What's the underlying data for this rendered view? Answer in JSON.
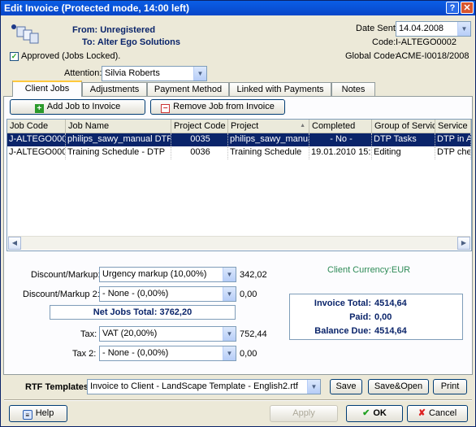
{
  "window": {
    "title": "Edit Invoice (Protected mode, 14:00 left)"
  },
  "header": {
    "from": "From: Unregistered",
    "to": "To: Alter Ego Solutions",
    "approved_label": "Approved (Jobs Locked).",
    "approved_checked": true,
    "attention_label": "Attention:",
    "attention_value": "Silvia Roberts",
    "date_sent_label": "Date Sent:",
    "date_sent_value": "14.04.2008",
    "code_label": "Code:",
    "code_value": "I-ALTEGO0002",
    "global_code_label": "Global Code:",
    "global_code_value": "ACME-I0018/2008"
  },
  "tabs": [
    {
      "label": "Client Jobs",
      "active": true
    },
    {
      "label": "Adjustments",
      "active": false
    },
    {
      "label": "Payment Method",
      "active": false
    },
    {
      "label": "Linked with Payments",
      "active": false
    },
    {
      "label": "Notes",
      "active": false
    }
  ],
  "toolbar": {
    "add_job_label": "Add Job to Invoice",
    "remove_job_label": "Remove Job from Invoice"
  },
  "jobs_table": {
    "columns": [
      "Job Code",
      "Job Name",
      "Project Code",
      "Project",
      "Completed",
      "Group of Service",
      "Service"
    ],
    "rows": [
      [
        "J-ALTEGO000",
        "philips_sawy_manual DTP",
        "0035",
        "philips_sawy_manual",
        "- No -",
        "DTP Tasks",
        "DTP in Ad"
      ],
      [
        "J-ALTEGO000",
        "Training Schedule - DTP",
        "0036",
        "Training Schedule",
        "19.01.2010 15:1",
        "Editing",
        "DTP check"
      ]
    ]
  },
  "totals": {
    "discount_label": "Discount/Markup:",
    "discount_value": "Urgency markup (10,00%)",
    "discount_amount": "342,02",
    "discount2_label": "Discount/Markup 2:",
    "discount2_value": "- None - (0,00%)",
    "discount2_amount": "0,00",
    "net_jobs_total": "Net Jobs Total: 3762,20",
    "tax_label": "Tax:",
    "tax_value": "VAT (20,00%)",
    "tax_amount": "752,44",
    "tax2_label": "Tax 2:",
    "tax2_value": "- None - (0,00%)",
    "tax2_amount": "0,00",
    "client_currency": "Client Currency:EUR",
    "invoice_total_label": "Invoice Total:",
    "invoice_total_value": "4514,64",
    "paid_label": "Paid:",
    "paid_value": "0,00",
    "balance_due_label": "Balance Due:",
    "balance_due_value": "4514,64"
  },
  "rtf": {
    "label": "RTF Templates:",
    "value": "Invoice to Client - LandScape Template - English2.rtf",
    "save_label": "Save",
    "save_open_label": "Save&Open",
    "print_label": "Print"
  },
  "footer": {
    "help_label": "Help",
    "apply_label": "Apply",
    "ok_label": "OK",
    "cancel_label": "Cancel"
  },
  "colors": {
    "accent": "#0a246a",
    "title_bar": "#0a5ee6",
    "currency_green": "#2e8b57"
  }
}
